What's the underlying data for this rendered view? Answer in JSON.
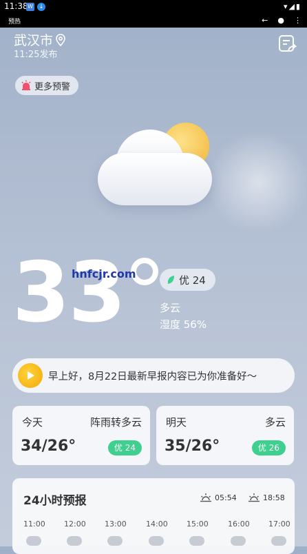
{
  "status_bar": {
    "time": "11:38"
  },
  "app_bar": {
    "title": "预热"
  },
  "header": {
    "city": "武汉市",
    "publish_time": "11:25发布"
  },
  "warning": {
    "label": "更多预警"
  },
  "current": {
    "temperature": "33",
    "aqi": "优 24",
    "condition": "多云",
    "humidity": "湿度 56%",
    "watermark": "hnfcjr.com"
  },
  "banner": {
    "text": "早上好，8月22日最新早报内容已为你准备好～"
  },
  "today": {
    "day": "今天",
    "desc": "阵雨转多云",
    "range": "34/26°",
    "aqi": "优 24"
  },
  "tomorrow": {
    "day": "明天",
    "desc": "多云",
    "range": "35/26°",
    "aqi": "优 26"
  },
  "hourly": {
    "title": "24小时预报",
    "sunrise": "05:54",
    "sunset": "18:58",
    "hours": [
      "11:00",
      "12:00",
      "13:00",
      "14:00",
      "15:00",
      "16:00",
      "17:00"
    ]
  },
  "colors": {
    "aqi_green": "#3fcf8e",
    "play_yellow": "#f3a70a",
    "sun": "#f2b739"
  }
}
